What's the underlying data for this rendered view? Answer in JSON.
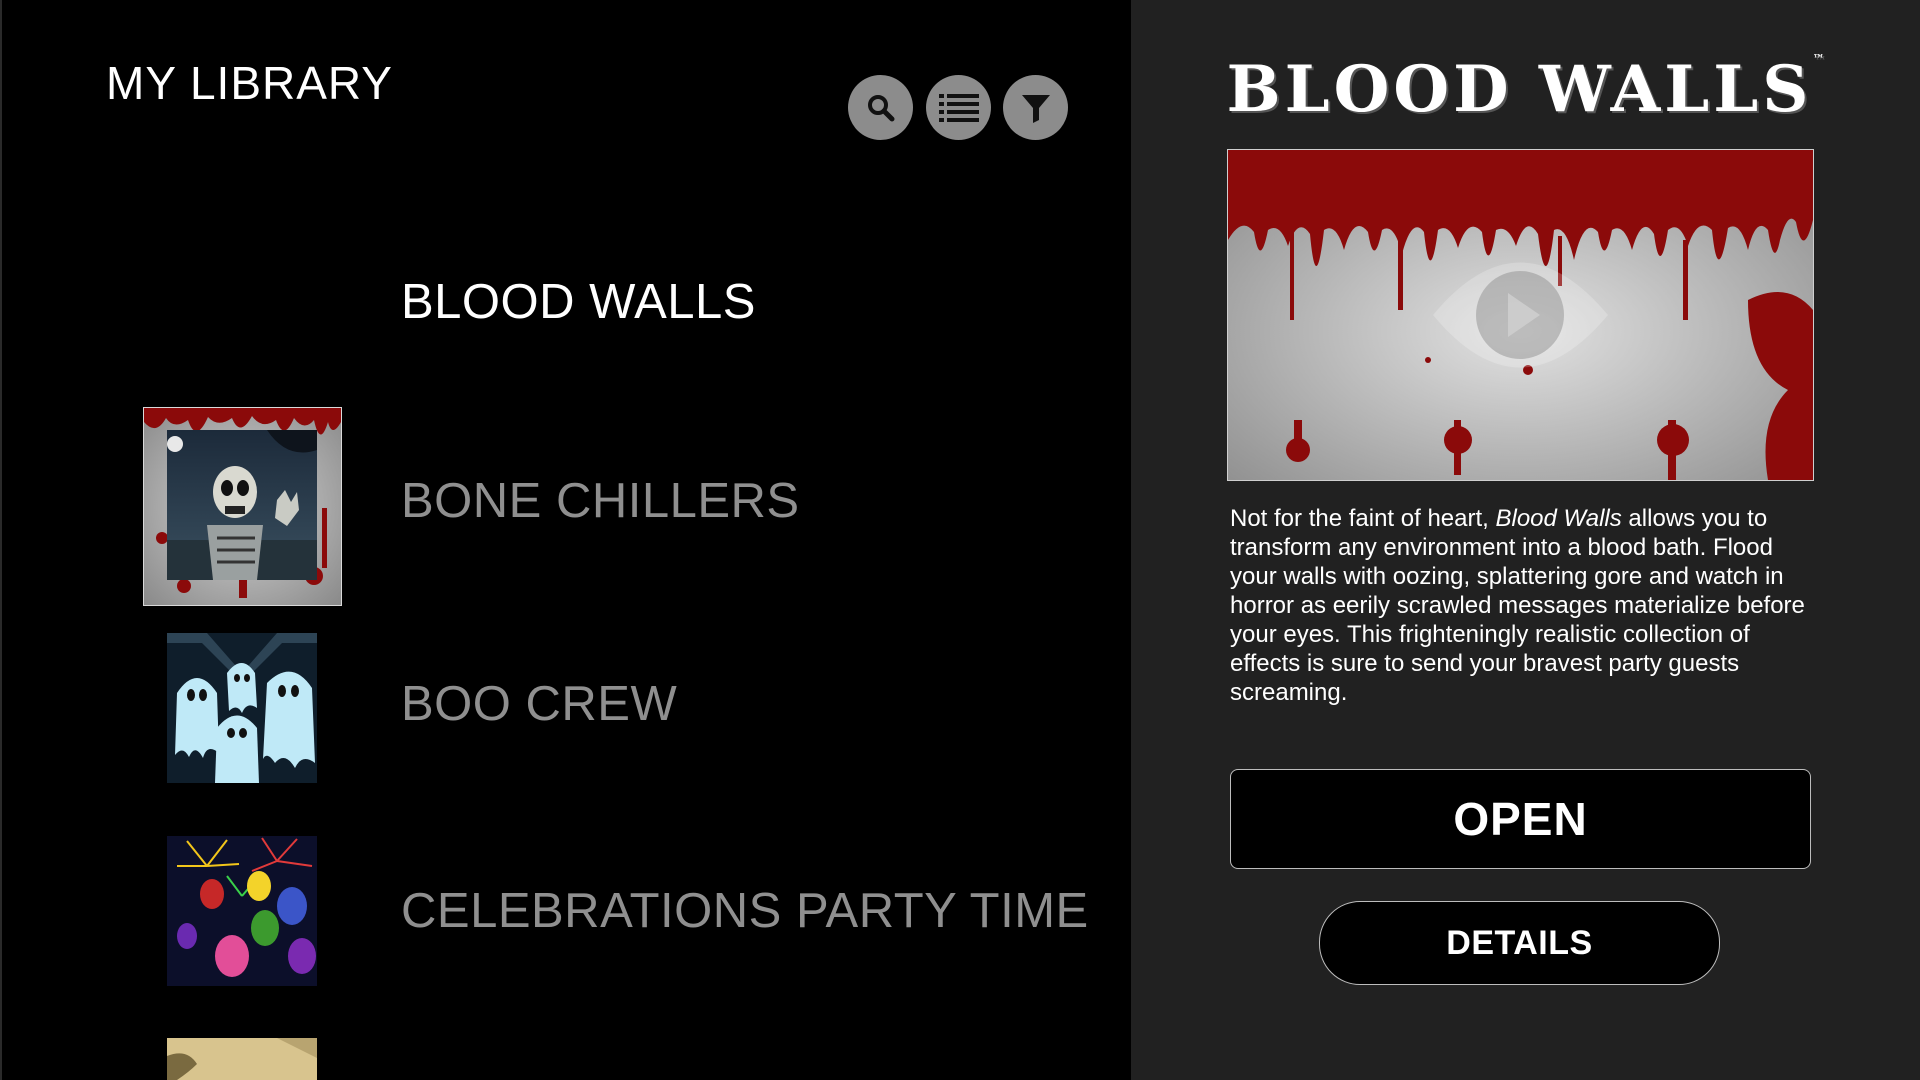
{
  "library": {
    "title": "MY LIBRARY",
    "toolbar": [
      {
        "icon": "search-icon"
      },
      {
        "icon": "list-icon"
      },
      {
        "icon": "filter-icon"
      }
    ],
    "items": [
      {
        "label": "BLOOD WALLS",
        "selected": true,
        "thumb": "bloody-handprint"
      },
      {
        "label": "BONE CHILLERS",
        "selected": false,
        "thumb": "skeleton"
      },
      {
        "label": "BOO CREW",
        "selected": false,
        "thumb": "ghosts"
      },
      {
        "label": "CELEBRATIONS PARTY TIME",
        "selected": false,
        "thumb": "balloons-fireworks"
      }
    ]
  },
  "detail": {
    "logo_title": "BLOOD WALLS",
    "logo_tm": "™",
    "description_pre": "Not for the faint of heart, ",
    "description_em": "Blood Walls",
    "description_post": " allows you to transform any environment into a blood bath. Flood your walls with oozing, splattering gore and watch in horror as eerily scrawled messages materialize before your eyes. This frighteningly realistic collection of effects is sure to send your bravest party guests screaming.",
    "open_label": "OPEN",
    "details_label": "DETAILS"
  },
  "colors": {
    "left_bg": "#000000",
    "right_bg": "#212121",
    "selected_text": "#ffffff",
    "unselected_text": "#8f8f8f",
    "icon_button": "#8c8c8c",
    "blood": "#8b0a0a"
  }
}
